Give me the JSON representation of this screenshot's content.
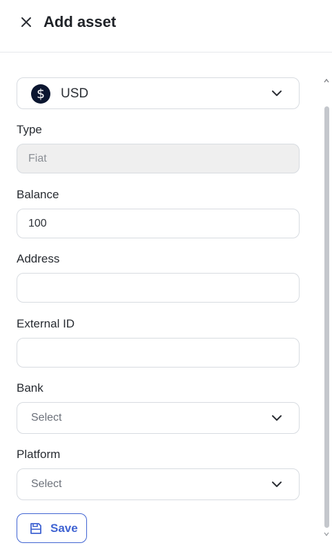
{
  "header": {
    "title": "Add asset"
  },
  "currency": {
    "symbol": "$",
    "label": "USD",
    "icon": "dollar-coin-icon"
  },
  "form": {
    "type_label": "Type",
    "type_value": "Fiat",
    "balance_label": "Balance",
    "balance_value": "100",
    "address_label": "Address",
    "address_value": "",
    "external_id_label": "External ID",
    "external_id_value": "",
    "bank_label": "Bank",
    "bank_value": "Select",
    "platform_label": "Platform",
    "platform_value": "Select",
    "save_label": "Save"
  },
  "colors": {
    "accent": "#3f63d2",
    "coin": "#0b1630",
    "border": "#d7dbe0",
    "disabled_bg": "#efefef"
  }
}
